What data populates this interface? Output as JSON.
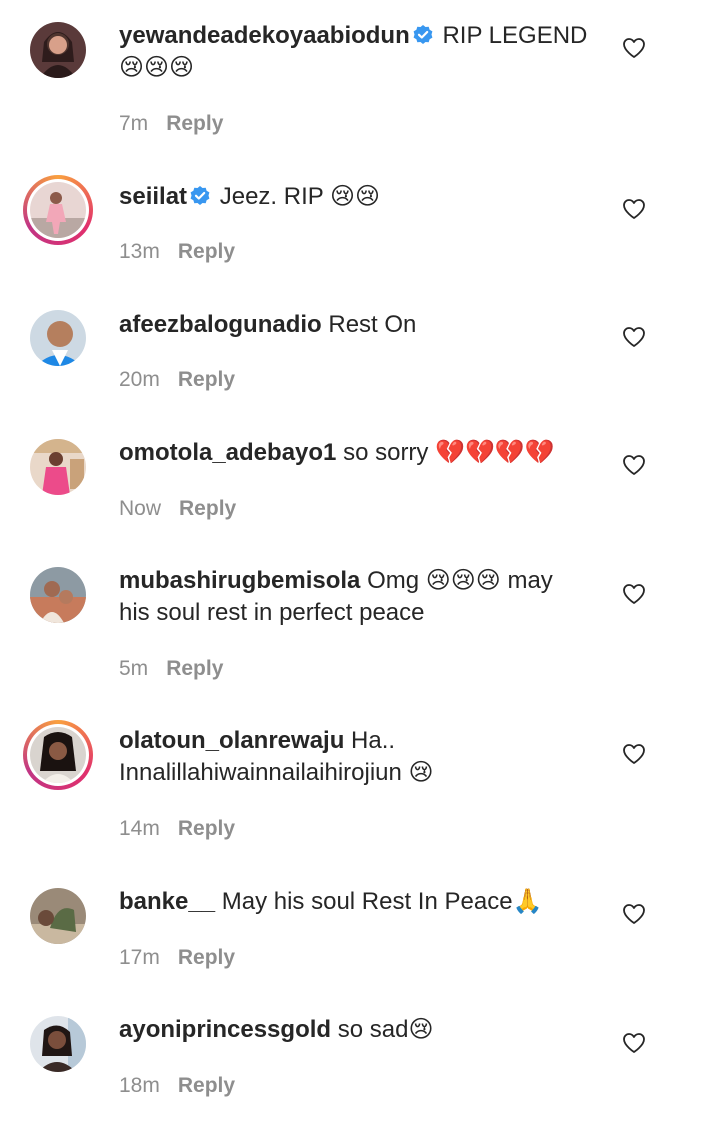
{
  "comments": [
    {
      "username": "yewandeadekoyaabiodun",
      "verified": true,
      "text": "RIP LEGEND 😢😢😢",
      "time": "7m",
      "reply": "Reply"
    },
    {
      "username": "seiilat",
      "verified": true,
      "text": "Jeez. RIP 😢😢",
      "time": "13m",
      "reply": "Reply"
    },
    {
      "username": "afeezbalogunadio",
      "verified": false,
      "text": "Rest On",
      "time": "20m",
      "reply": "Reply"
    },
    {
      "username": "omotola_adebayo1",
      "verified": false,
      "text": "so sorry 💔💔💔💔",
      "time": "Now",
      "reply": "Reply"
    },
    {
      "username": "mubashirugbemisola",
      "verified": false,
      "text": "Omg 😢😢😢 may his soul rest in perfect peace",
      "time": "5m",
      "reply": "Reply"
    },
    {
      "username": "olatoun_olanrewaju",
      "verified": false,
      "text": "Ha.. Innalillahiwainnailaihirojiun 😢",
      "time": "14m",
      "reply": "Reply"
    },
    {
      "username": "banke__",
      "verified": false,
      "text": "May his soul Rest In Peace🙏",
      "time": "17m",
      "reply": "Reply"
    },
    {
      "username": "ayoniprincessgold",
      "verified": false,
      "text": "so sad😢",
      "time": "18m",
      "reply": "Reply"
    }
  ],
  "colors": {
    "text": "#262626",
    "muted": "#8e8e8e",
    "verified_badge": "#3897f0",
    "story_ring": "#e1306c"
  },
  "icons": {
    "like": "heart-outline-icon",
    "verified": "verified-badge-icon"
  }
}
